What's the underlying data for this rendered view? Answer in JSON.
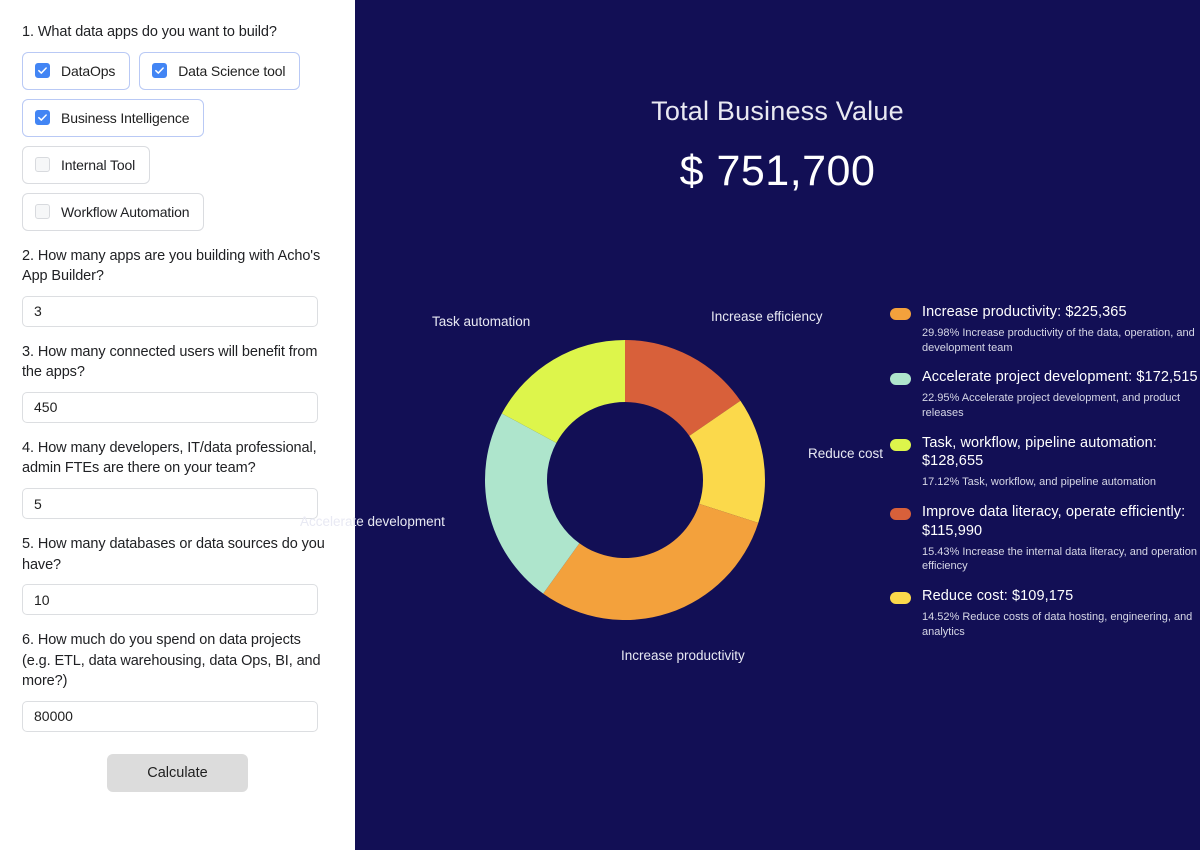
{
  "form": {
    "questions": [
      {
        "label": "1. What data apps do you want to build?"
      },
      {
        "label": "2. How many apps are you building with Acho's App Builder?",
        "value": "3"
      },
      {
        "label": "3. How many connected users will benefit from the apps?",
        "value": "450"
      },
      {
        "label": "4. How many developers, IT/data professional, admin FTEs are there on your team?",
        "value": "5"
      },
      {
        "label": "5. How many databases or data sources do you have?",
        "value": "10"
      },
      {
        "label": "6. How much do you spend on data projects (e.g. ETL, data warehousing, data Ops, BI, and more?)",
        "value": "80000"
      }
    ],
    "options": [
      {
        "label": "DataOps",
        "checked": true
      },
      {
        "label": "Data Science tool",
        "checked": true
      },
      {
        "label": "Business Intelligence",
        "checked": true
      },
      {
        "label": "Internal Tool",
        "checked": false
      },
      {
        "label": "Workflow Automation",
        "checked": false
      }
    ],
    "submit_label": "Calculate",
    "accent_checked": "#4285f4",
    "border_checked": "#b9c9f5",
    "border_unchecked": "#dadce0"
  },
  "result": {
    "title": "Total Business Value",
    "total": "$ 751,700",
    "background": "#120f55"
  },
  "chart_data": {
    "type": "pie",
    "title": "Total Business Value",
    "legend_position": "right",
    "total": 751700,
    "categories": [
      "Increase efficiency",
      "Reduce cost",
      "Increase productivity",
      "Accelerate development",
      "Task automation"
    ],
    "values": [
      115990,
      109175,
      225365,
      172515,
      128655
    ],
    "percents": [
      15.43,
      14.52,
      29.98,
      22.95,
      17.12
    ],
    "colors": [
      "#d8603a",
      "#fbd94b",
      "#f3a13c",
      "#aee5cc",
      "#ddf54b"
    ],
    "slice_labels": [
      "Increase efficiency",
      "Reduce cost",
      "Increase productivity",
      "Accelerate development",
      "Task automation"
    ],
    "legend": [
      {
        "title": "Increase productivity: $225,365",
        "desc": "29.98% Increase productivity of the data, operation, and development team",
        "color": "#f3a13c",
        "value": 225365,
        "percent": 29.98
      },
      {
        "title": "Accelerate project development: $172,515",
        "desc": "22.95% Accelerate project development, and product releases",
        "color": "#aee5cc",
        "value": 172515,
        "percent": 22.95
      },
      {
        "title": "Task, workflow, pipeline automation: $128,655",
        "desc": "17.12% Task, workflow, and pipeline automation",
        "color": "#ddf54b",
        "value": 128655,
        "percent": 17.12
      },
      {
        "title": "Improve data literacy, operate efficiently: $115,990",
        "desc": "15.43% Increase the internal data literacy, and operation efficiency",
        "color": "#d8603a",
        "value": 115990,
        "percent": 15.43
      },
      {
        "title": "Reduce cost: $109,175",
        "desc": "14.52% Reduce costs of data hosting, engineering, and analytics",
        "color": "#fbd94b",
        "value": 109175,
        "percent": 14.52
      }
    ]
  }
}
